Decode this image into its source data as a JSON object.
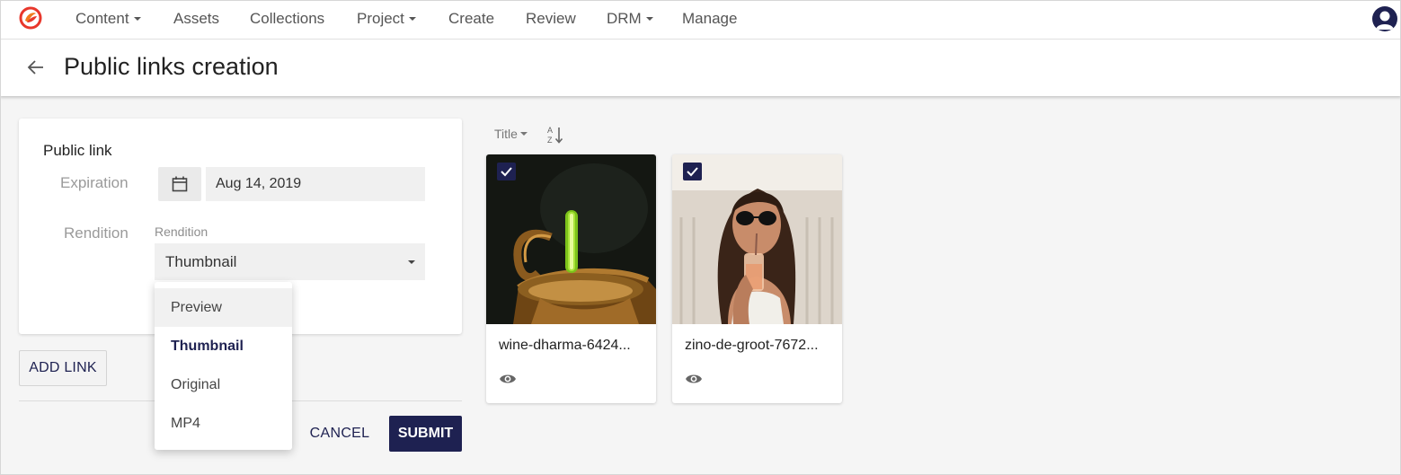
{
  "nav": {
    "items": [
      {
        "label": "Content",
        "has_caret": true
      },
      {
        "label": "Assets",
        "has_caret": false
      },
      {
        "label": "Collections",
        "has_caret": false
      },
      {
        "label": "Project",
        "has_caret": true
      },
      {
        "label": "Create",
        "has_caret": false
      },
      {
        "label": "Review",
        "has_caret": false
      },
      {
        "label": "DRM",
        "has_caret": true
      },
      {
        "label": "Manage",
        "has_caret": false
      }
    ],
    "logo_icon": "brand-logo-icon",
    "avatar_icon": "user-avatar-icon"
  },
  "header": {
    "title": "Public links creation",
    "back_icon": "arrow-left-icon"
  },
  "form": {
    "heading": "Public link",
    "expiration_label": "Expiration",
    "expiration_date": "Aug 14, 2019",
    "calendar_icon": "calendar-icon",
    "rendition_label": "Rendition",
    "rendition_field_label": "Rendition",
    "rendition_value": "Thumbnail",
    "add_link_label": "ADD LINK",
    "cancel_label": "CANCEL",
    "submit_label": "SUBMIT"
  },
  "rendition_menu": {
    "options": [
      "Preview",
      "Thumbnail",
      "Original",
      "MP4"
    ],
    "hovered": "Preview",
    "selected": "Thumbnail"
  },
  "sort": {
    "label": "Title",
    "order_icon": "sort-alpha-ascending-icon"
  },
  "assets": [
    {
      "name": "wine-dharma-6424...",
      "checked": true,
      "preview_icon": "eye-icon"
    },
    {
      "name": "zino-de-groot-7672...",
      "checked": true,
      "preview_icon": "eye-icon"
    }
  ],
  "colors": {
    "primary": "#1e2151",
    "brand": "#e8372c",
    "background": "#f5f5f5"
  }
}
